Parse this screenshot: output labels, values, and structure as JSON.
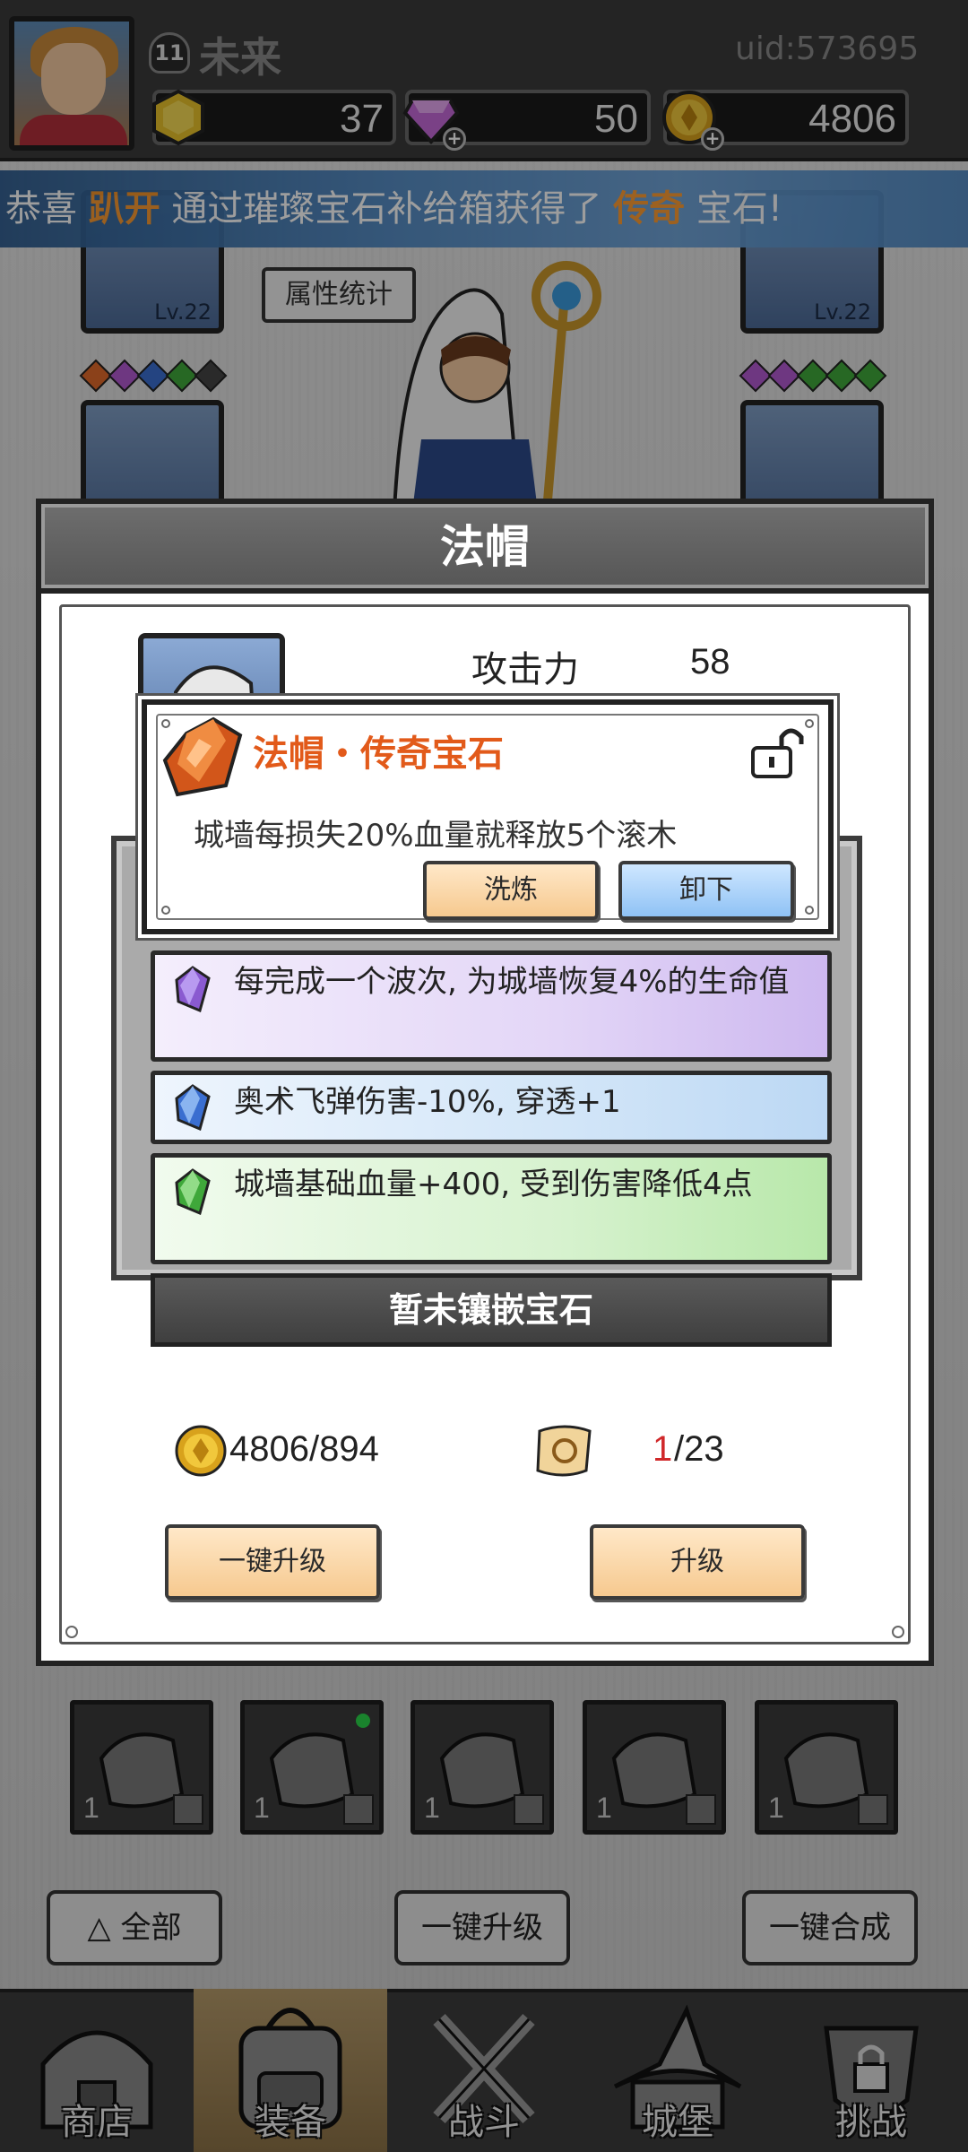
{
  "player": {
    "level": "11",
    "name": "未来",
    "uid": "uid:573695"
  },
  "resources": {
    "gold_coin": "37",
    "gem": "50",
    "coin": "4806"
  },
  "announcement": {
    "prefix": "恭喜 ",
    "player": "趴开",
    "middle": " 通过璀璨宝石补给箱获得了 ",
    "item": "传奇",
    "suffix": " 宝石!"
  },
  "equipment": {
    "left_slot_level": "Lv.22",
    "right_slot_level": "Lv.22",
    "stats_button": "属性统计"
  },
  "modal": {
    "title": "法帽",
    "attack_label": "攻击力",
    "attack_value": "58",
    "popup": {
      "title": "法帽・传奇宝石",
      "description": "城墙每损失20%血量就释放5个滚木",
      "refine_button": "洗炼",
      "remove_button": "卸下"
    },
    "gems": [
      {
        "text": "每完成一个波次, 为城墙恢复4%的生命值",
        "color": "#8a5ad0"
      },
      {
        "text": "奥术飞弹伤害-10%, 穿透+1",
        "color": "#3a6ed0"
      },
      {
        "text": "城墙基础血量+400, 受到伤害降低4点",
        "color": "#3fa83a"
      }
    ],
    "empty_socket": "暂未镶嵌宝石",
    "cost": {
      "gold": "4806/894",
      "scroll_have": "1",
      "scroll_total": "/23"
    },
    "one_click_upgrade": "一键升级",
    "upgrade": "升级"
  },
  "inventory": {
    "counts": [
      "1",
      "1",
      "1",
      "1",
      "1"
    ]
  },
  "bottom_buttons": {
    "all": "全部",
    "one_click_upgrade": "一键升级",
    "one_click_merge": "一键合成"
  },
  "nav": {
    "shop": "商店",
    "equipment": "装备",
    "battle": "战斗",
    "castle": "城堡",
    "challenge": "挑战"
  },
  "colors": {
    "accent_orange": "#e25a1a",
    "announce_blue": "#4f88c2",
    "cost_red": "#d0282a"
  }
}
